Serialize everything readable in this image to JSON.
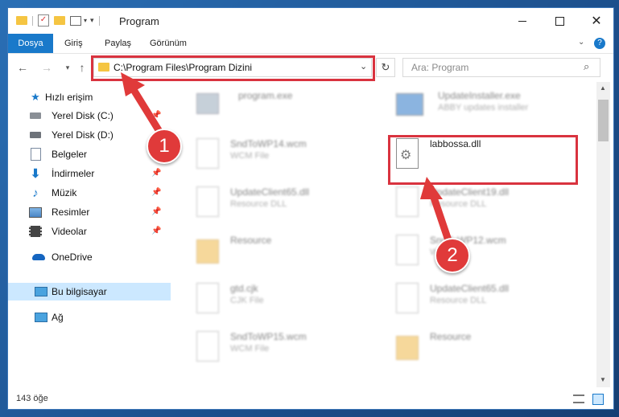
{
  "window": {
    "title": "Program"
  },
  "ribbon": {
    "tabs": [
      "Dosya",
      "Giriş",
      "Paylaş",
      "Görünüm"
    ]
  },
  "address": {
    "path": "C:\\Program Files\\Program Dizini"
  },
  "search": {
    "placeholder": "Ara: Program"
  },
  "sidebar": {
    "items": [
      {
        "label": "Hızlı erişim",
        "icon": "star-icon"
      },
      {
        "label": "Yerel Disk (C:)",
        "icon": "disk-icon"
      },
      {
        "label": "Yerel Disk (D:)",
        "icon": "disk-icon"
      },
      {
        "label": "Belgeler",
        "icon": "documents-icon"
      },
      {
        "label": "İndirmeler",
        "icon": "download-icon"
      },
      {
        "label": "Müzik",
        "icon": "music-icon"
      },
      {
        "label": "Resimler",
        "icon": "pictures-icon"
      },
      {
        "label": "Videolar",
        "icon": "video-icon"
      },
      {
        "label": "OneDrive",
        "icon": "cloud-icon"
      },
      {
        "label": "Bu bilgisayar",
        "icon": "computer-icon"
      },
      {
        "label": "Ağ",
        "icon": "network-icon"
      }
    ]
  },
  "files": [
    {
      "name": "program.exe",
      "type": ""
    },
    {
      "name": "UpdateInstaller.exe",
      "type": "ABBY updates installer"
    },
    {
      "name": "SndToWP14.wcm",
      "type": "WCM File"
    },
    {
      "name": "labbossa.dll",
      "type": ""
    },
    {
      "name": "UpdateClient65.dll",
      "type": "Resource DLL"
    },
    {
      "name": "UpdateClient19.dll",
      "type": "Resource DLL"
    },
    {
      "name": "Resource",
      "type": ""
    },
    {
      "name": "SndToWP12.wcm",
      "type": "WCM File"
    },
    {
      "name": "gtd.cjk",
      "type": "CJK File"
    },
    {
      "name": "UpdateClient65.dll",
      "type": "Resource DLL"
    },
    {
      "name": "SndToWP15.wcm",
      "type": "WCM File"
    },
    {
      "name": "Resource",
      "type": ""
    }
  ],
  "status": {
    "count": "143 öğe"
  },
  "annotations": {
    "badge1": "1",
    "badge2": "2"
  },
  "colors": {
    "accent": "#1979ca",
    "highlight": "#d9333f",
    "selected": "#cce8ff"
  }
}
